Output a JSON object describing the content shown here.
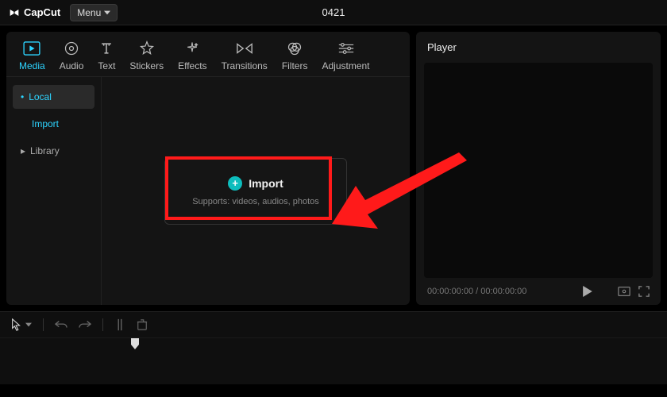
{
  "app": {
    "name": "CapCut",
    "menu_label": "Menu"
  },
  "project": {
    "title": "0421"
  },
  "tabs": [
    {
      "id": "media",
      "label": "Media"
    },
    {
      "id": "audio",
      "label": "Audio"
    },
    {
      "id": "text",
      "label": "Text"
    },
    {
      "id": "stickers",
      "label": "Stickers"
    },
    {
      "id": "effects",
      "label": "Effects"
    },
    {
      "id": "transitions",
      "label": "Transitions"
    },
    {
      "id": "filters",
      "label": "Filters"
    },
    {
      "id": "adjustment",
      "label": "Adjustment"
    }
  ],
  "sidebar": {
    "items": [
      {
        "id": "local",
        "label": "Local",
        "bullet": "•"
      },
      {
        "id": "import",
        "label": "Import"
      },
      {
        "id": "library",
        "label": "Library",
        "prefix": "▸"
      }
    ]
  },
  "import_box": {
    "label": "Import",
    "subtext": "Supports: videos, audios, photos",
    "plus": "+"
  },
  "player": {
    "title": "Player",
    "timecode": "00:00:00:00 / 00:00:00:00"
  },
  "annotation": {
    "highlight_color": "#ff1a1a",
    "arrow_color": "#ff1a1a"
  }
}
